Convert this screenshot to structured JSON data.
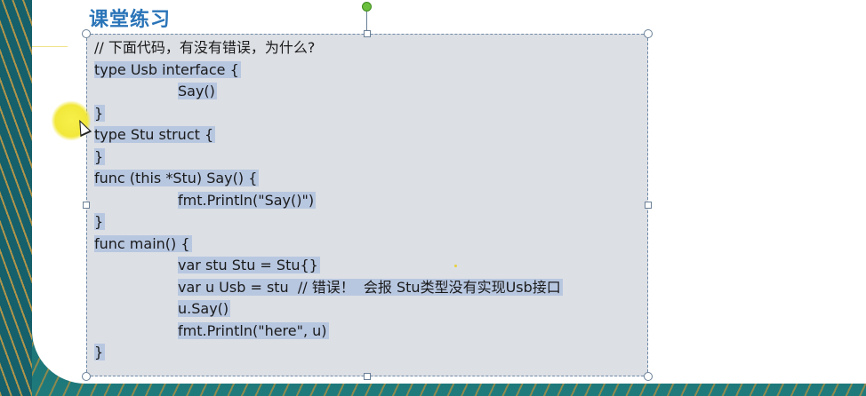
{
  "slide": {
    "title": "课堂练习"
  },
  "code": {
    "lines": [
      {
        "indent": 0,
        "text": "// 下面代码，有没有错误，为什么?",
        "comment": true
      },
      {
        "indent": 0,
        "text": "type Usb interface {"
      },
      {
        "indent": 1,
        "text": "Say()"
      },
      {
        "indent": 0,
        "text": "}"
      },
      {
        "indent": 0,
        "text": "type Stu struct {"
      },
      {
        "indent": 0,
        "text": "}"
      },
      {
        "indent": 0,
        "text": "func (this *Stu) Say() {"
      },
      {
        "indent": 1,
        "text": "fmt.Println(\"Say()\")"
      },
      {
        "indent": 0,
        "text": "}"
      },
      {
        "indent": 0,
        "text": "func main() {"
      },
      {
        "indent": 1,
        "text": "var stu Stu = Stu{}"
      },
      {
        "indent": 1,
        "text": "var u Usb = stu  // 错误！  会报 Stu类型没有实现Usb接口"
      },
      {
        "indent": 1,
        "text": "u.Say()"
      },
      {
        "indent": 1,
        "text": "fmt.Println(\"here\", u)"
      },
      {
        "indent": 0,
        "text": "}"
      }
    ]
  },
  "colors": {
    "title": "#2a74b8",
    "selection": "#b8c7e0",
    "frame": "#1e6f73"
  }
}
